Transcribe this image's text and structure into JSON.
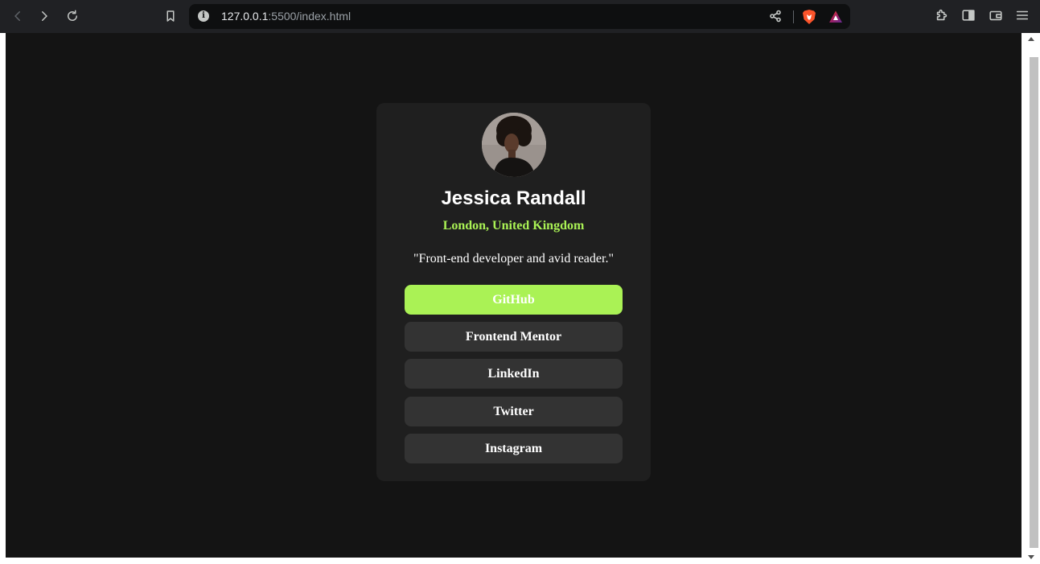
{
  "browser": {
    "url_host": "127.0.0.1",
    "url_rest": ":5500/index.html"
  },
  "profile": {
    "name": "Jessica Randall",
    "location": "London, United Kingdom",
    "bio": "\"Front-end developer and avid reader.\"",
    "links": [
      {
        "label": "GitHub",
        "active": true
      },
      {
        "label": "Frontend Mentor",
        "active": false
      },
      {
        "label": "LinkedIn",
        "active": false
      },
      {
        "label": "Twitter",
        "active": false
      },
      {
        "label": "Instagram",
        "active": false
      }
    ]
  },
  "colors": {
    "accent": "#aaf255",
    "background": "#141414",
    "card": "#1f1f1f",
    "button": "#333333"
  },
  "icons": [
    "back-icon",
    "forward-icon",
    "reload-icon",
    "bookmark-icon",
    "site-info-icon",
    "share-icon",
    "brave-shields-icon",
    "brave-rewards-icon",
    "extensions-icon",
    "sidebar-icon",
    "wallet-icon",
    "menu-icon"
  ]
}
